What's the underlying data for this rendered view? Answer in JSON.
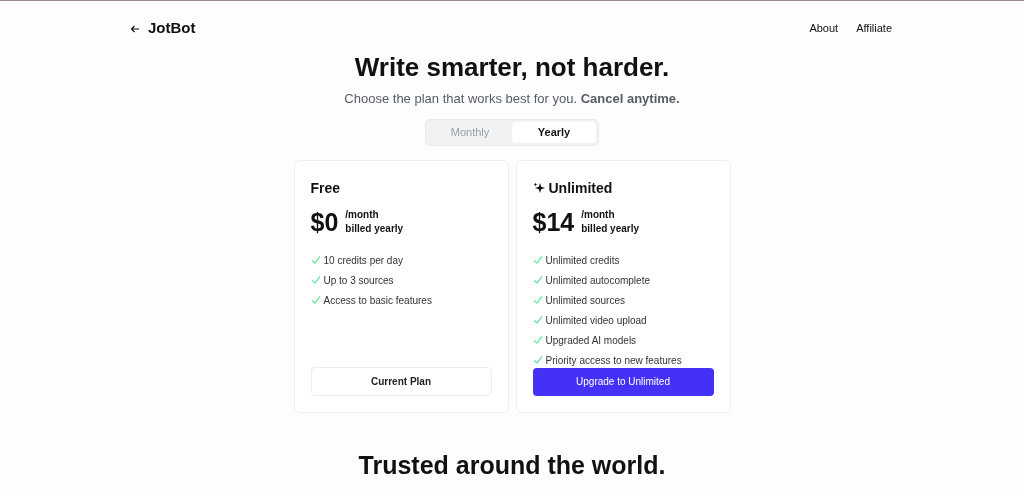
{
  "header": {
    "brand": "JotBot",
    "nav": [
      "About",
      "Affiliate"
    ]
  },
  "hero": {
    "title": "Write smarter, not harder.",
    "subtitle": "Choose the plan that works best for you. **Cancel anytime.**"
  },
  "billing_toggle": [
    {
      "label": "Monthly",
      "selected": false
    },
    {
      "label": "Yearly",
      "selected": true
    }
  ],
  "plans": [
    {
      "name": "Free",
      "featured": false,
      "price": "$0",
      "period": "/month",
      "billing": "billed yearly",
      "features": [
        "10 credits per day",
        "Up to 3 sources",
        "Access to basic features"
      ],
      "button": "Current Plan"
    },
    {
      "name": "Unlimited",
      "featured": true,
      "price": "$14",
      "period": "/month",
      "billing": "billed yearly",
      "features": [
        "Unlimited credits",
        "Unlimited autocomplete",
        "Unlimited sources",
        "Unlimited video upload",
        "Upgraded AI models",
        "Priority access to new features"
      ],
      "button": "Upgrade to Unlimited"
    }
  ],
  "section_title": "Trusted around the world."
}
